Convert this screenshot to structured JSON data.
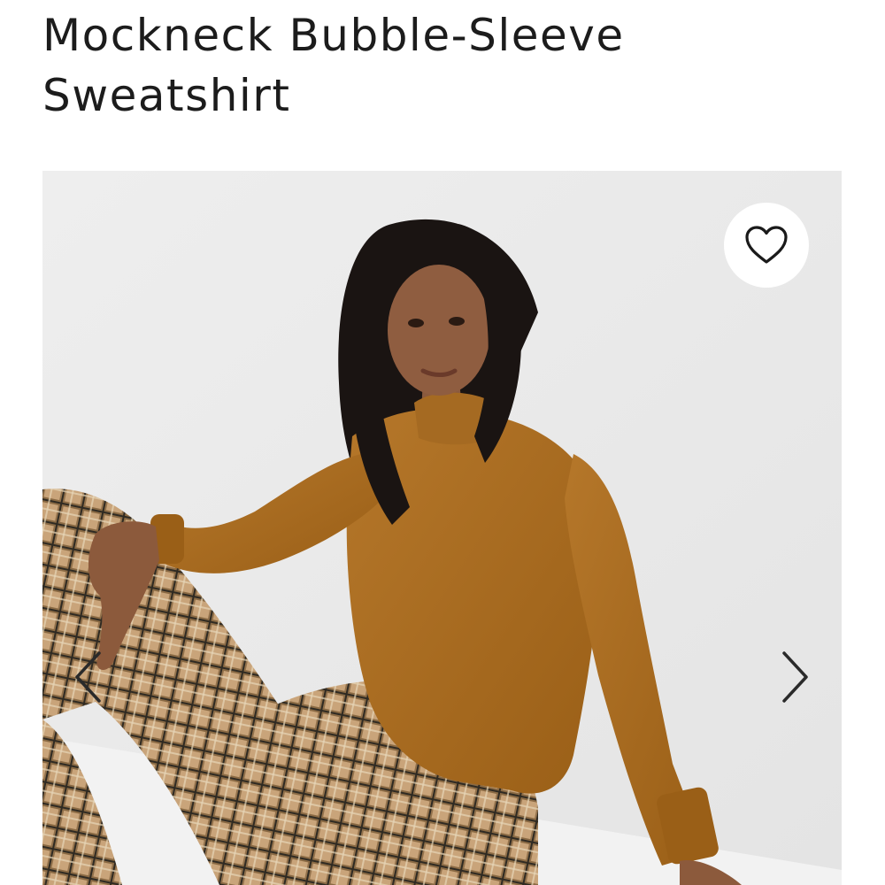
{
  "product": {
    "title": "Mockneck Bubble-Sleeve Sweatshirt"
  },
  "gallery": {
    "image_alt": "Model wearing a rust-brown mockneck bubble-sleeve sweatshirt with plaid pants, seated against a white wall",
    "wishlist_icon": "heart-icon",
    "prev_icon": "chevron-left-icon",
    "next_icon": "chevron-right-icon"
  },
  "colors": {
    "sweatshirt": "#a86a1f",
    "background": "#ececec",
    "text": "#1c1c1c"
  }
}
